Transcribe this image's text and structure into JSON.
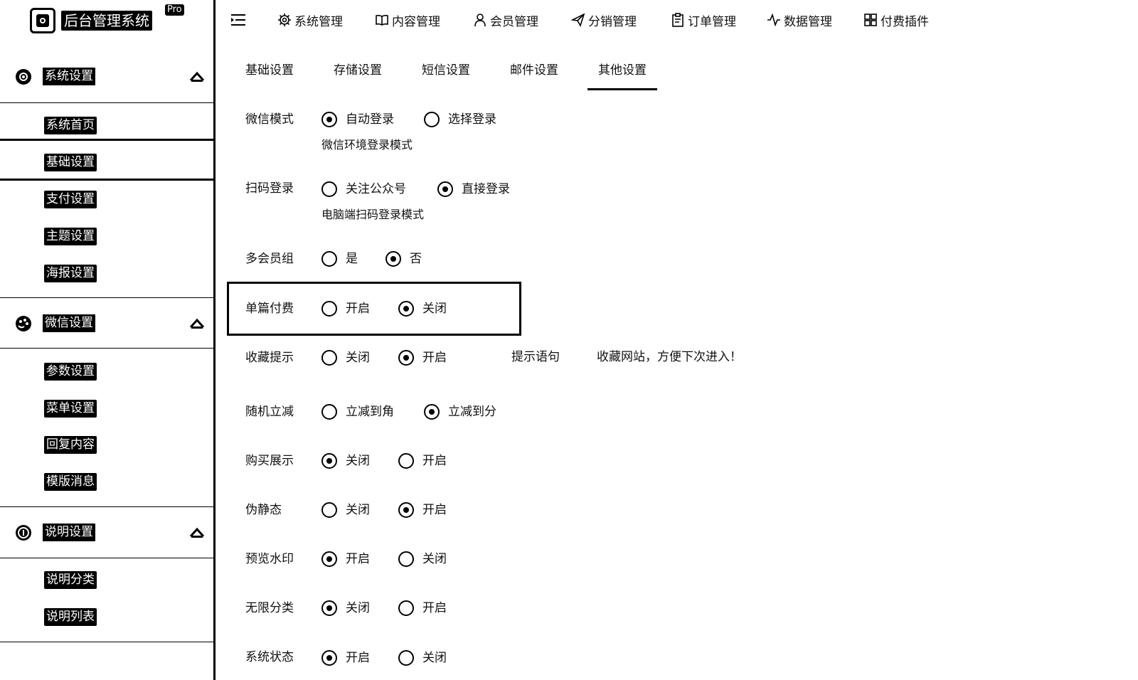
{
  "logo": {
    "title": "后台管理系统",
    "badge": "Pro"
  },
  "sidebar": {
    "groups": [
      {
        "label": "系统设置",
        "items": [
          "系统首页",
          "基础设置",
          "支付设置",
          "主题设置",
          "海报设置"
        ]
      },
      {
        "label": "微信设置",
        "items": [
          "参数设置",
          "菜单设置",
          "回复内容",
          "模版消息"
        ]
      },
      {
        "label": "说明设置",
        "items": [
          "说明分类",
          "说明列表"
        ]
      }
    ],
    "active_item": "基础设置"
  },
  "topnav": {
    "items": [
      "系统管理",
      "内容管理",
      "会员管理",
      "分销管理",
      "订单管理",
      "数据管理",
      "付费插件"
    ]
  },
  "tabs": [
    "基础设置",
    "存储设置",
    "短信设置",
    "邮件设置",
    "其他设置"
  ],
  "active_tab": "其他设置",
  "form": {
    "wechat_mode": {
      "label": "微信模式",
      "options": [
        "自动登录",
        "选择登录"
      ],
      "selected": "自动登录",
      "help": "微信环境登录模式"
    },
    "scan_login": {
      "label": "扫码登录",
      "options": [
        "关注公众号",
        "直接登录"
      ],
      "selected": "直接登录",
      "help": "电脑端扫码登录模式"
    },
    "multi_group": {
      "label": "多会员组",
      "options": [
        "是",
        "否"
      ],
      "selected": "否"
    },
    "single_pay": {
      "label": "单篇付费",
      "options": [
        "开启",
        "关闭"
      ],
      "selected": "关闭"
    },
    "fav_tip": {
      "label": "收藏提示",
      "options": [
        "关闭",
        "开启"
      ],
      "selected": "开启",
      "tip_label": "提示语句",
      "tip_value": "收藏网站，方便下次进入！"
    },
    "random_discount": {
      "label": "随机立减",
      "options": [
        "立减到角",
        "立减到分"
      ],
      "selected": "立减到分"
    },
    "purchase_display": {
      "label": "购买展示",
      "options": [
        "关闭",
        "开启"
      ],
      "selected": "关闭"
    },
    "pseudo_static": {
      "label": "伪静态",
      "options": [
        "关闭",
        "开启"
      ],
      "selected": "开启"
    },
    "preview_watermark": {
      "label": "预览水印",
      "options": [
        "开启",
        "关闭"
      ],
      "selected": "开启"
    },
    "unlimited_category": {
      "label": "无限分类",
      "options": [
        "关闭",
        "开启"
      ],
      "selected": "关闭"
    },
    "system_status": {
      "label": "系统状态",
      "options": [
        "开启",
        "关闭"
      ],
      "selected": "开启"
    }
  }
}
